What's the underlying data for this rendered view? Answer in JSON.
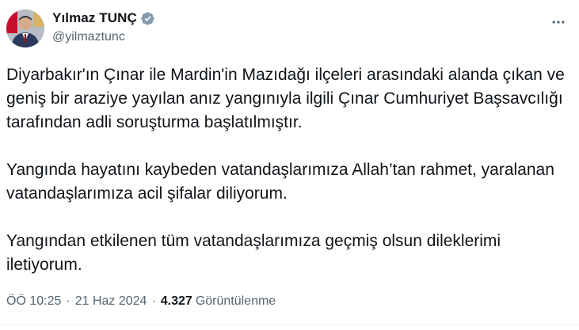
{
  "author": {
    "display_name": "Yılmaz TUNÇ",
    "handle": "@yilmaztunc",
    "verified_icon": "verified-badge-icon",
    "verified_color": "#829aab"
  },
  "actions": {
    "more_icon": "more-horizontal-icon"
  },
  "tweet": {
    "paragraphs": [
      "Diyarbakır'ın Çınar ile Mardin'in Mazıdağı ilçeleri arasındaki alanda çıkan ve geniş bir araziye yayılan anız yangınıyla ilgili Çınar Cumhuriyet Başsavcılığı tarafından adli soruşturma başlatılmıştır.",
      "Yangında hayatını kaybeden vatandaşlarımıza Allah’tan rahmet, yaralanan vatandaşlarımıza acil şifalar diliyorum.",
      "Yangından etkilenen tüm vatandaşlarımıza geçmiş olsun dileklerimi iletiyorum."
    ]
  },
  "meta": {
    "time": "ÖÖ 10:25",
    "separator": "·",
    "date": "21 Haz 2024",
    "views_count": "4.327",
    "views_label": "Görüntülenme"
  },
  "colors": {
    "text_primary": "#0f1419",
    "text_secondary": "#536471",
    "divider": "#eff3f4"
  }
}
